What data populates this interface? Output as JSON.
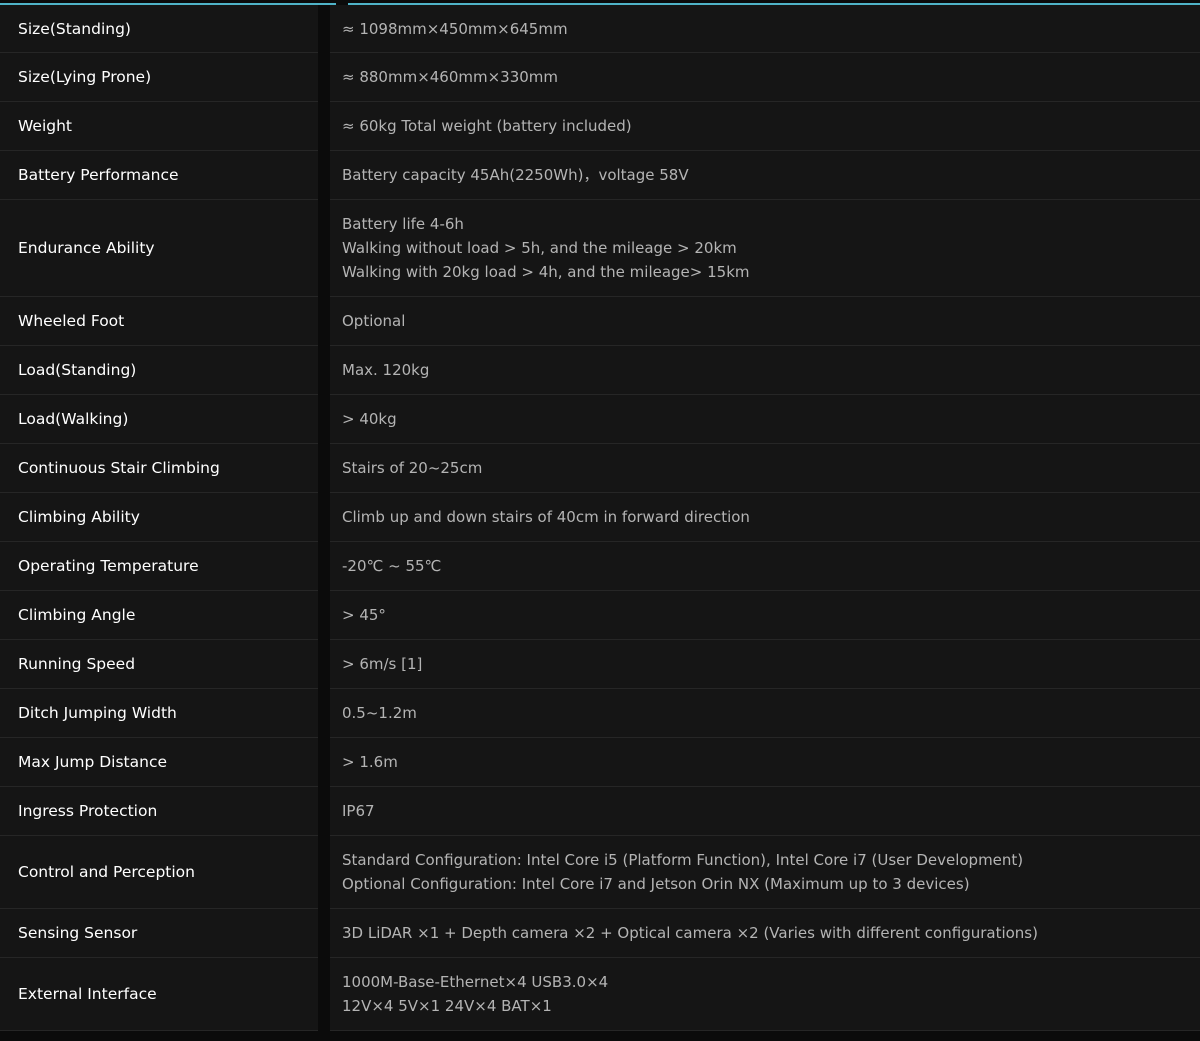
{
  "specs": [
    {
      "label": "Size(Standing)",
      "lines": [
        "≈ 1098mm×450mm×645mm"
      ]
    },
    {
      "label": "Size(Lying Prone)",
      "lines": [
        "≈ 880mm×460mm×330mm"
      ]
    },
    {
      "label": "Weight",
      "lines": [
        "≈ 60kg Total weight (battery included)"
      ]
    },
    {
      "label": "Battery Performance",
      "lines": [
        "Battery capacity 45Ah(2250Wh)，voltage 58V"
      ]
    },
    {
      "label": "Endurance Ability",
      "lines": [
        "Battery life 4-6h",
        "Walking without load > 5h, and the mileage > 20km",
        "Walking with 20kg load > 4h, and the mileage> 15km"
      ]
    },
    {
      "label": "Wheeled Foot",
      "lines": [
        "Optional"
      ]
    },
    {
      "label": "Load(Standing)",
      "lines": [
        "Max. 120kg"
      ]
    },
    {
      "label": "Load(Walking)",
      "lines": [
        "> 40kg"
      ]
    },
    {
      "label": "Continuous Stair Climbing",
      "lines": [
        "Stairs of 20~25cm"
      ]
    },
    {
      "label": "Climbing Ability",
      "lines": [
        "Climb up and down stairs of 40cm in forward direction"
      ]
    },
    {
      "label": "Operating Temperature",
      "lines": [
        "-20℃ ~ 55℃"
      ]
    },
    {
      "label": "Climbing Angle",
      "lines": [
        "> 45°"
      ]
    },
    {
      "label": "Running Speed",
      "lines": [
        "> 6m/s [1]"
      ]
    },
    {
      "label": "Ditch Jumping Width",
      "lines": [
        "0.5~1.2m"
      ]
    },
    {
      "label": "Max Jump Distance",
      "lines": [
        "> 1.6m"
      ]
    },
    {
      "label": "Ingress Protection",
      "lines": [
        "IP67"
      ]
    },
    {
      "label": "Control and Perception",
      "lines": [
        "Standard Configuration: Intel Core i5 (Platform Function), Intel Core i7 (User Development)",
        "Optional Configuration: Intel Core i7 and Jetson Orin NX (Maximum up to 3 devices)"
      ]
    },
    {
      "label": "Sensing Sensor",
      "lines": [
        "3D LiDAR ×1 + Depth camera ×2 + Optical camera ×2 (Varies with different configurations)"
      ]
    },
    {
      "label": "External Interface",
      "lines": [
        "1000M-Base-Ethernet×4 USB3.0×4",
        "12V×4 5V×1 24V×4 BAT×1"
      ]
    }
  ],
  "colors": {
    "accent": "#4fb3c8",
    "background": "#0b0b0b",
    "cell": "#151515",
    "label_text": "#ffffff",
    "value_text": "#b4b4b4"
  }
}
